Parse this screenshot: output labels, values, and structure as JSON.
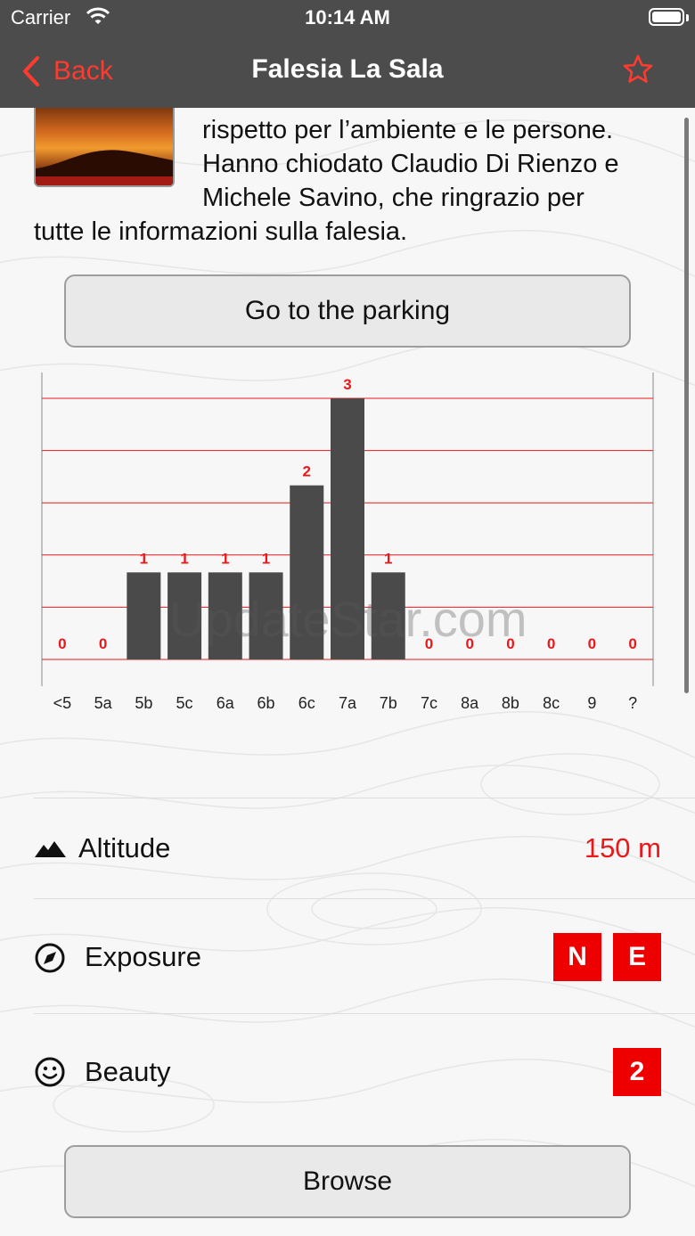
{
  "status_bar": {
    "carrier": "Carrier",
    "time": "10:14 AM"
  },
  "nav": {
    "back_label": "Back",
    "title": "Falesia La Sala"
  },
  "description": {
    "lines": [
      "rispetto per l’ambiente e le persone.",
      "Hanno chiodato Claudio Di Rienzo e",
      "Michele Savino, che ringrazio per",
      "tutte le informazioni sulla falesia."
    ]
  },
  "parking_button": {
    "label": "Go to the parking"
  },
  "chart_data": {
    "type": "bar",
    "categories": [
      "<5",
      "5a",
      "5b",
      "5c",
      "6a",
      "6b",
      "6c",
      "7a",
      "7b",
      "7c",
      "8a",
      "8b",
      "8c",
      "9",
      "?"
    ],
    "values": [
      0,
      0,
      1,
      1,
      1,
      1,
      2,
      3,
      1,
      0,
      0,
      0,
      0,
      0,
      0
    ],
    "ylim": [
      0,
      3
    ],
    "grid": true,
    "bar_color": "#4a4a4a",
    "grid_color": "#e8181b",
    "label_color": "#e8181b"
  },
  "watermark": "UpdateStar.com",
  "details": {
    "altitude": {
      "label": "Altitude",
      "value": "150 m",
      "icon": "mountain-icon"
    },
    "exposure": {
      "label": "Exposure",
      "values": [
        "N",
        "E"
      ],
      "icon": "compass-icon"
    },
    "beauty": {
      "label": "Beauty",
      "value": "2",
      "icon": "smiley-icon"
    }
  },
  "browse_button": {
    "label": "Browse"
  },
  "colors": {
    "accent": "#ff3b30",
    "bar_bg": "#4c4c4c",
    "badge": "#ee0000"
  }
}
